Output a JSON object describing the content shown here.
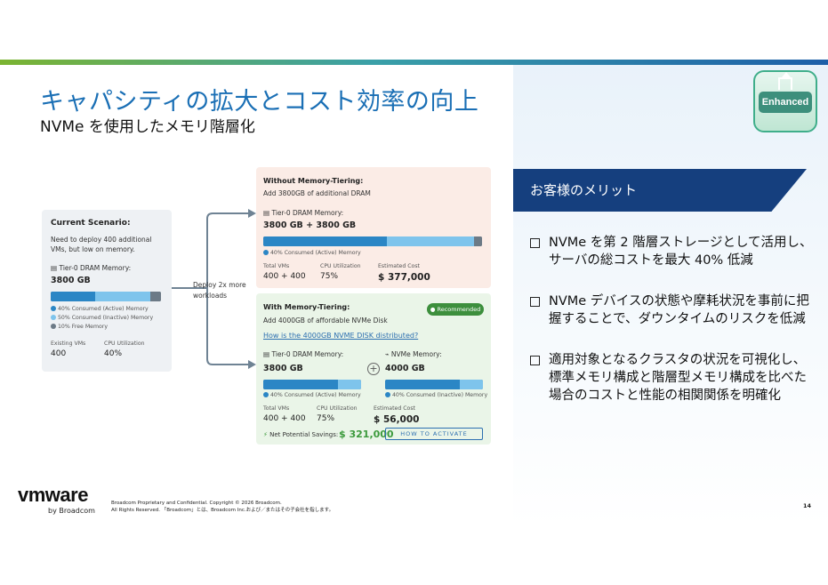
{
  "header": {
    "title": "キャパシティの拡大とコスト効率の向上",
    "subtitle": "NVMe を使用したメモリ階層化"
  },
  "badge": {
    "label": "Enhanced"
  },
  "benefits": {
    "heading": "お客様のメリット",
    "items": [
      "NVMe を第 2 階層ストレージとして活用し、サーバの総コストを最大 40% 低減",
      "NVMe デバイスの状態や摩耗状況を事前に把握することで、ダウンタイムのリスクを低減",
      "適用対象となるクラスタの状況を可視化し、標準メモリ構成と階層型メモリ構成を比べた場合のコストと性能の相関関係を明確化"
    ]
  },
  "diagram": {
    "current": {
      "heading": "Current Scenario:",
      "desc_line1": "Need to deploy 400 additional",
      "desc_line2": "VMs, but low on memory.",
      "mem_label": "Tier-0 DRAM Memory:",
      "mem_value": "3800 GB",
      "bar": [
        0.4,
        0.5,
        0.1
      ],
      "legend": [
        "40% Consumed (Active) Memory",
        "50% Consumed (Inactive) Memory",
        "10% Free Memory"
      ],
      "stat1_label": "Existing VMs",
      "stat1_value": "400",
      "stat2_label": "CPU Utilization",
      "stat2_value": "40%"
    },
    "arrow_label_line1": "Deploy 2x more",
    "arrow_label_line2": "workloads",
    "without": {
      "heading": "Without Memory-Tiering:",
      "desc": "Add 3800GB of additional DRAM",
      "mem_label": "Tier-0 DRAM Memory:",
      "mem_value": "3800 GB + 3800 GB",
      "bar": [
        0.565,
        0.4,
        0.035
      ],
      "legend": "40% Consumed (Active) Memory",
      "stat1_label": "Total VMs",
      "stat1_value": "400 + 400",
      "stat2_label": "CPU Utilization",
      "stat2_value": "75%",
      "stat3_label": "Estimated Cost",
      "stat3_value": "$ 377,000"
    },
    "with": {
      "heading": "With Memory-Tiering:",
      "recommended": "Recommended",
      "desc": "Add 4000GB of affordable NVMe Disk",
      "link": "How is the 4000GB NVME DISK distributed?",
      "dram_label": "Tier-0 DRAM Memory:",
      "dram_value": "3800 GB",
      "nvme_label": "NVMe Memory:",
      "nvme_value": "4000 GB",
      "dram_bar": [
        0.76,
        0.24
      ],
      "nvme_bar": [
        0.76,
        0.24
      ],
      "dram_legend": "40% Consumed (Active) Memory",
      "nvme_legend": "40% Consumed (Inactive) Memory",
      "stat1_label": "Total VMs",
      "stat1_value": "400 + 400",
      "stat2_label": "CPU Utilization",
      "stat2_value": "75%",
      "stat3_label": "Estimated Cost",
      "stat3_value": "$ 56,000",
      "savings_label": "Net Potential Savings:",
      "savings_value": "$ 321,000",
      "activate": "HOW TO ACTIVATE"
    }
  },
  "colors": {
    "active": "#2b86c5",
    "inactive": "#7ec4ec",
    "free": "#6c7a86"
  },
  "footer": {
    "logo": "vmware",
    "logo_sub": "by Broadcom",
    "legal_line1": "Broadcom Proprietary and Confidential. Copyright © 2026 Broadcom.",
    "legal_line2": "All Rights Reserved. 「Broadcom」とは、Broadcom Inc.および／またはその子会社を指します。",
    "page": "14"
  }
}
